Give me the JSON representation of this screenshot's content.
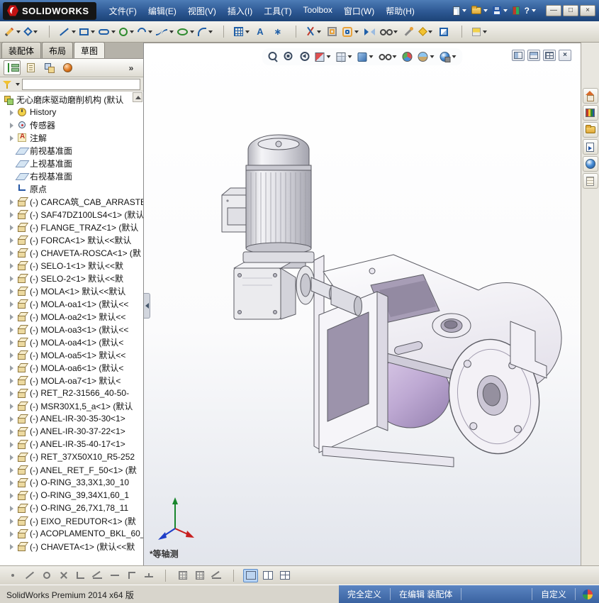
{
  "colors": {
    "titlebar_blue": "#2d5893",
    "statusbar_blue": "#3a62a0",
    "selection_blue": "#bcd4f0",
    "model_accent_lavender": "#bea9d3"
  },
  "window": {
    "logo_text": "SOLIDWORKS"
  },
  "menubar": {
    "items": [
      {
        "label": "文件(F)",
        "name": "menu-file"
      },
      {
        "label": "编辑(E)",
        "name": "menu-edit"
      },
      {
        "label": "视图(V)",
        "name": "menu-view"
      },
      {
        "label": "插入(I)",
        "name": "menu-insert"
      },
      {
        "label": "工具(T)",
        "name": "menu-tools"
      },
      {
        "label": "Toolbox",
        "name": "menu-toolbox"
      },
      {
        "label": "窗口(W)",
        "name": "menu-window"
      },
      {
        "label": "帮助(H)",
        "name": "menu-help"
      }
    ]
  },
  "titlebar": {
    "tools": [
      {
        "name": "new-document-button",
        "glyph": "newdoc",
        "dd": true
      },
      {
        "name": "open-button",
        "glyph": "open",
        "dd": true
      },
      {
        "name": "save-button",
        "glyph": "save",
        "dd": true
      },
      {
        "name": "options-toggle-button",
        "glyph": "toggle"
      },
      {
        "name": "help-button",
        "char": "?",
        "dd": true
      }
    ],
    "window_buttons": [
      {
        "name": "minimize-button",
        "char": "—"
      },
      {
        "name": "restore-button",
        "char": "□"
      },
      {
        "name": "close-button",
        "char": "×"
      }
    ]
  },
  "tabs": [
    {
      "label": "装配体",
      "name": "tab-assembly"
    },
    {
      "label": "布局",
      "name": "tab-layout"
    },
    {
      "label": "草图",
      "name": "tab-sketch",
      "active": true
    }
  ],
  "toolbar": {
    "buttons": [
      {
        "name": "sketch-button",
        "glyph": "pencil",
        "dd": true
      },
      {
        "name": "smart-dimension-button",
        "glyph": "dim",
        "dd": true
      },
      {
        "name": "toolbar-separator",
        "glyph": "sep"
      },
      {
        "name": "line-button",
        "glyph": "line",
        "dd": true
      },
      {
        "name": "rectangle-button",
        "glyph": "rect",
        "dd": true
      },
      {
        "name": "slot-button",
        "glyph": "slot",
        "dd": true
      },
      {
        "name": "circle-button",
        "glyph": "circle",
        "dd": true
      },
      {
        "name": "arc-button",
        "glyph": "arc",
        "dd": true
      },
      {
        "name": "spline-button",
        "glyph": "spline",
        "dd": true
      },
      {
        "name": "ellipse-button",
        "glyph": "ellipse",
        "dd": true
      },
      {
        "name": "fillet-button",
        "glyph": "fillet",
        "dd": true
      },
      {
        "name": "toolbar-separator",
        "glyph": "sep"
      },
      {
        "name": "pattern-button",
        "glyph": "grid",
        "dd": true
      },
      {
        "name": "text-button",
        "char": "A"
      },
      {
        "name": "point-button",
        "char": "∗"
      },
      {
        "name": "toolbar-separator",
        "glyph": "sep"
      },
      {
        "name": "trim-entities-button",
        "glyph": "trim",
        "dd": true
      },
      {
        "name": "convert-entities-button",
        "glyph": "convert"
      },
      {
        "name": "offset-entities-button",
        "glyph": "offset",
        "dd": true
      },
      {
        "name": "mirror-entities-button",
        "glyph": "mirror"
      },
      {
        "name": "display-relations-button",
        "glyph": "glasses",
        "dd": true
      },
      {
        "name": "repair-sketch-button",
        "glyph": "repair"
      },
      {
        "name": "quick-snaps-button",
        "glyph": "snap",
        "dd": true
      },
      {
        "name": "rapid-sketch-button",
        "glyph": "rapid"
      },
      {
        "name": "toolbar-separator",
        "glyph": "sep"
      },
      {
        "name": "instant2d-button",
        "glyph": "instant",
        "dd": true
      }
    ]
  },
  "panel": {
    "filter_placeholder": "",
    "tabs": [
      {
        "name": "featuremanager-tab",
        "glyph": "fmtree",
        "active": true
      },
      {
        "name": "propertymanager-tab",
        "glyph": "pmgr"
      },
      {
        "name": "configurationmanager-tab",
        "glyph": "cfg"
      },
      {
        "name": "displaymanager-tab",
        "glyph": "dmgr"
      },
      {
        "name": "panel-flyout-button",
        "char": "»"
      }
    ]
  },
  "tree": {
    "root": {
      "label": "无心磨床驱动磨削机构 (默认"
    },
    "items": [
      {
        "icon": "history",
        "exp": true,
        "label": "History"
      },
      {
        "icon": "sensor",
        "exp": true,
        "label": "传感器"
      },
      {
        "icon": "ann",
        "exp": true,
        "label": "注解"
      },
      {
        "icon": "plane",
        "label": "前视基准面"
      },
      {
        "icon": "plane",
        "label": "上视基准面"
      },
      {
        "icon": "plane",
        "label": "右视基准面"
      },
      {
        "icon": "origin",
        "label": "原点"
      },
      {
        "icon": "part",
        "exp": true,
        "label": "(-) CARCA筑_CAB_ARRASTE"
      },
      {
        "icon": "part",
        "exp": true,
        "label": "(-) SAF47DZ100LS4<1> (默认"
      },
      {
        "icon": "part",
        "exp": true,
        "label": "(-) FLANGE_TRAZ<1> (默认"
      },
      {
        "icon": "part",
        "exp": true,
        "label": "(-) FORCA<1> 默认<<默认"
      },
      {
        "icon": "part",
        "exp": true,
        "label": "(-) CHAVETA-ROSCA<1> (默"
      },
      {
        "icon": "part",
        "exp": true,
        "label": "(-) SELO-1<1> 默认<<默"
      },
      {
        "icon": "part",
        "exp": true,
        "label": "(-) SELO-2<1> 默认<<默"
      },
      {
        "icon": "part",
        "exp": true,
        "label": "(-) MOLA<1> 默认<<默认"
      },
      {
        "icon": "part",
        "exp": true,
        "label": "(-) MOLA-oa1<1> (默认<<"
      },
      {
        "icon": "part",
        "exp": true,
        "label": "(-) MOLA-oa2<1> 默认<<"
      },
      {
        "icon": "part",
        "exp": true,
        "label": "(-) MOLA-oa3<1> (默认<<"
      },
      {
        "icon": "part",
        "exp": true,
        "label": "(-) MOLA-oa4<1> (默认<"
      },
      {
        "icon": "part",
        "exp": true,
        "label": "(-) MOLA-oa5<1> 默认<<"
      },
      {
        "icon": "part",
        "exp": true,
        "label": "(-) MOLA-oa6<1> (默认<"
      },
      {
        "icon": "part",
        "exp": true,
        "label": "(-) MOLA-oa7<1> 默认<"
      },
      {
        "icon": "part",
        "exp": true,
        "label": "(-) RET_R2-31566_40-50-"
      },
      {
        "icon": "part",
        "exp": true,
        "label": "(-) MSR30X1,5_a<1> (默认"
      },
      {
        "icon": "part",
        "exp": true,
        "label": "(-) ANEL-IR-30-35-30<1>"
      },
      {
        "icon": "part",
        "exp": true,
        "label": "(-) ANEL-IR-30-37-22<1>"
      },
      {
        "icon": "part",
        "exp": true,
        "label": "(-) ANEL-IR-35-40-17<1>"
      },
      {
        "icon": "part",
        "exp": true,
        "label": "(-) RET_37X50X10_R5-252"
      },
      {
        "icon": "part",
        "exp": true,
        "label": "(-) ANEL_RET_F_50<1> (默"
      },
      {
        "icon": "part",
        "exp": true,
        "label": "(-) O-RING_33,3X1,30_10"
      },
      {
        "icon": "part",
        "exp": true,
        "label": "(-) O-RING_39,34X1,60_1"
      },
      {
        "icon": "part",
        "exp": true,
        "label": "(-) O-RING_26,7X1,78_11"
      },
      {
        "icon": "part",
        "exp": true,
        "label": "(-) EIXO_REDUTOR<1> (默"
      },
      {
        "icon": "part",
        "exp": true,
        "label": "(-) ACOPLAMENTO_BKL_60_"
      },
      {
        "icon": "part",
        "exp": true,
        "label": "(-) CHAVETA<1> (默认<<默"
      }
    ]
  },
  "viewport": {
    "view_label": "*等轴测",
    "toolbar": [
      {
        "name": "zoom-fit-button",
        "glyph": "zoomfit"
      },
      {
        "name": "zoom-area-button",
        "glyph": "zoomarea"
      },
      {
        "name": "previous-view-button",
        "glyph": "prevview"
      },
      {
        "name": "section-view-button",
        "glyph": "section",
        "dd": true
      },
      {
        "name": "view-orientation-button",
        "glyph": "vcube",
        "dd": true
      },
      {
        "name": "display-style-button",
        "glyph": "dstyle",
        "dd": true
      },
      {
        "name": "hide-show-items-button",
        "glyph": "glasses",
        "dd": true
      },
      {
        "name": "edit-appearance-button",
        "glyph": "ball"
      },
      {
        "name": "apply-scene-button",
        "glyph": "scene",
        "dd": true
      },
      {
        "name": "view-settings-button",
        "glyph": "ballgear",
        "dd": true
      }
    ],
    "pane_buttons": [
      {
        "name": "split-pane-left-button",
        "glyph": "pane1"
      },
      {
        "name": "split-pane-top-button",
        "glyph": "pane2"
      },
      {
        "name": "split-pane-quad-button",
        "glyph": "pane3"
      },
      {
        "name": "close-pane-button",
        "char": "×"
      }
    ]
  },
  "taskpane": {
    "tabs": [
      {
        "name": "resources-tab",
        "glyph": "home"
      },
      {
        "name": "design-library-tab",
        "glyph": "library"
      },
      {
        "name": "file-explorer-tab",
        "glyph": "open"
      },
      {
        "name": "view-palette-tab",
        "glyph": "palette"
      },
      {
        "name": "appearances-tab",
        "glyph": "sphere"
      },
      {
        "name": "custom-properties-tab",
        "glyph": "props"
      }
    ]
  },
  "snapbar": {
    "buttons": [
      {
        "name": "snap-point-button",
        "glyph": "sdot"
      },
      {
        "name": "snap-line-button",
        "glyph": "sline"
      },
      {
        "name": "snap-circle-button",
        "glyph": "scircle"
      },
      {
        "name": "snap-intersection-button",
        "glyph": "sx"
      },
      {
        "name": "snap-perpendicular-button",
        "glyph": "sperp"
      },
      {
        "name": "snap-angle-button",
        "glyph": "sangle"
      },
      {
        "name": "snap-horizontal-button",
        "glyph": "sh"
      },
      {
        "name": "snap-corner-button",
        "glyph": "scorner"
      },
      {
        "name": "snap-midpoint-button",
        "glyph": "smid"
      },
      {
        "name": "toolbar-separator",
        "glyph": "sep"
      },
      {
        "name": "grid-snap-button",
        "glyph": "sgrid"
      },
      {
        "name": "grid-settings-button",
        "glyph": "sgrid"
      },
      {
        "name": "angle-snap-button",
        "glyph": "sangle"
      },
      {
        "name": "toolbar-separator",
        "glyph": "sep"
      },
      {
        "name": "shaded-display-button",
        "glyph": "win1",
        "active": true
      },
      {
        "name": "split-horizontal-button",
        "glyph": "win2"
      },
      {
        "name": "split-four-button",
        "glyph": "win3"
      }
    ]
  },
  "statusbar": {
    "app_version": "SolidWorks Premium 2014 x64 版",
    "defined_status": "完全定义",
    "editing_status": "在编辑 装配体",
    "custom_label": "自定义"
  }
}
